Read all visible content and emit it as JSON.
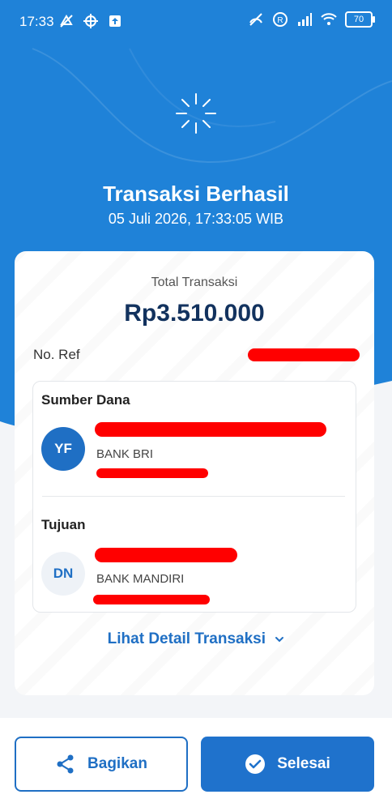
{
  "status_bar": {
    "time": "17:33",
    "battery": "70",
    "icons_left": [
      "mute-icon",
      "location-icon",
      "upload-icon"
    ],
    "icons_right": [
      "no-data-icon",
      "roaming-icon",
      "signal-icon",
      "wifi-icon",
      "battery-icon"
    ]
  },
  "header": {
    "title": "Transaksi Berhasil",
    "datetime": "05 Juli 2026, 17:33:05 WIB"
  },
  "summary": {
    "total_label": "Total Transaksi",
    "total_amount": "Rp3.510.000",
    "ref_label": "No. Ref"
  },
  "source": {
    "section_title": "Sumber Dana",
    "initials": "YF",
    "bank": "BANK BRI"
  },
  "destination": {
    "section_title": "Tujuan",
    "initials": "DN",
    "bank": "BANK MANDIRI"
  },
  "detail_link": "Lihat Detail Transaksi",
  "actions": {
    "share_label": "Bagikan",
    "done_label": "Selesai"
  },
  "colors": {
    "primary": "#1f82d8",
    "button": "#1f72cc",
    "amount_text": "#12325e",
    "redaction": "#ff0000"
  }
}
